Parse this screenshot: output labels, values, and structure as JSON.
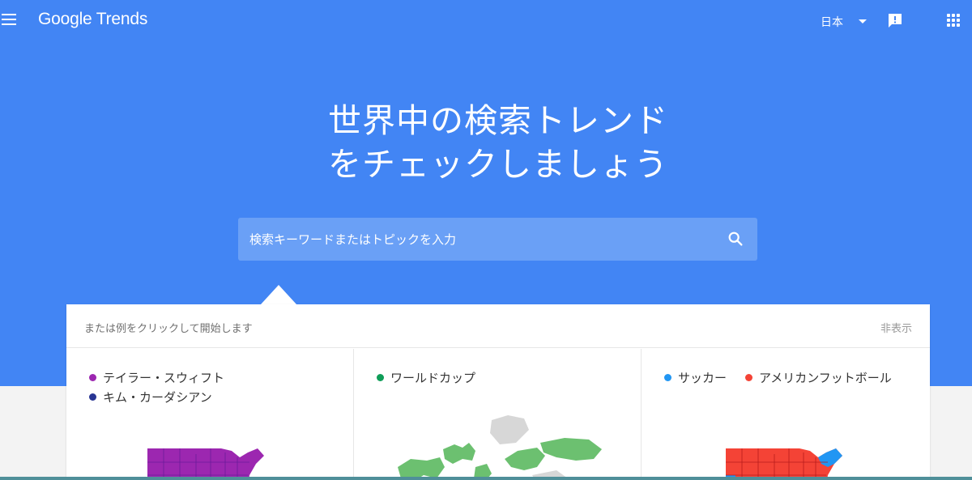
{
  "header": {
    "logo": "Google Trends",
    "language": "日本"
  },
  "hero": {
    "headline_line1": "世界中の検索トレンド",
    "headline_line2": "をチェックしましょう"
  },
  "search": {
    "placeholder": "検索キーワードまたはトピックを入力"
  },
  "examples_card": {
    "hint": "または例をクリックして開始します",
    "hide_label": "非表示",
    "examples": [
      {
        "terms": [
          {
            "label": "テイラー・スウィフト",
            "color": "#9c27b0"
          },
          {
            "label": "キム・カーダシアン",
            "color": "#283593"
          }
        ],
        "map": "usa-purple-map-icon"
      },
      {
        "terms": [
          {
            "label": "ワールドカップ",
            "color": "#0f9d58"
          }
        ],
        "map": "world-green-map-icon"
      },
      {
        "terms": [
          {
            "label": "サッカー",
            "color": "#2196f3"
          },
          {
            "label": "アメリカンフットボール",
            "color": "#f44336"
          }
        ],
        "map": "usa-red-map-icon"
      }
    ]
  },
  "colors": {
    "hero_blue": "#4285f4",
    "search_box": "#6aa0f6"
  }
}
